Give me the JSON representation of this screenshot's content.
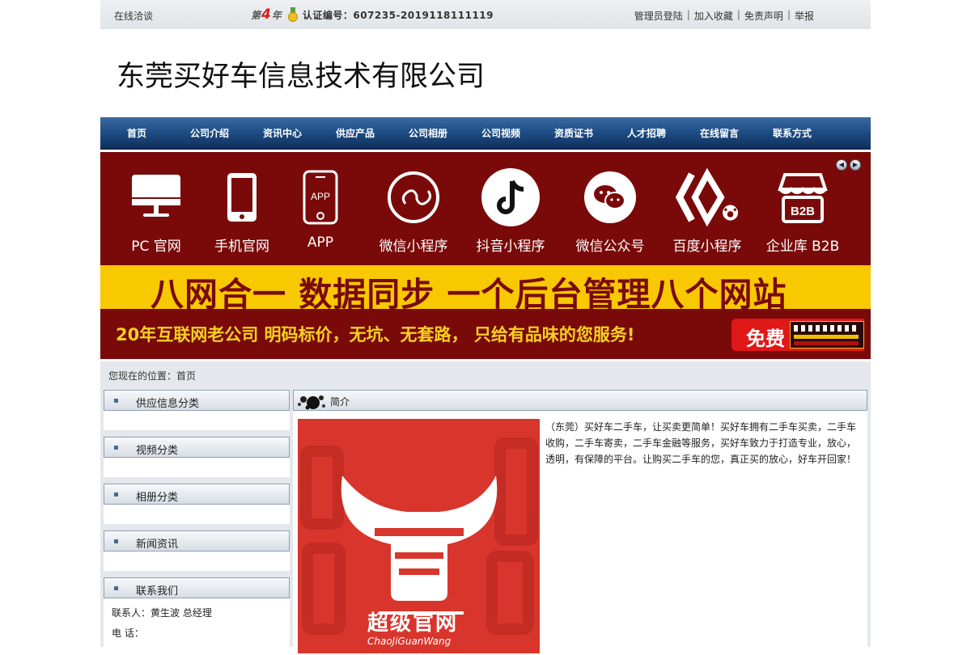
{
  "topbar": {
    "online": "在线洽谈",
    "year_prefix": "第",
    "year_num": "4",
    "year_suffix": "年",
    "cert_label": "认证编号：607235-2019118111119",
    "links": [
      "管理员登陆",
      "加入收藏",
      "免责声明",
      "举报"
    ]
  },
  "company_name": "东莞买好车信息技术有限公司",
  "nav": [
    "首页",
    "公司介绍",
    "资讯中心",
    "供应产品",
    "公司相册",
    "公司视频",
    "资质证书",
    "人才招聘",
    "在线留言",
    "联系方式"
  ],
  "banner": {
    "tiles": [
      {
        "label": "PC 官网",
        "icon": "monitor-icon"
      },
      {
        "label": "手机官网",
        "icon": "phone-icon"
      },
      {
        "label": "APP",
        "icon": "app-icon"
      },
      {
        "label": "微信小程序",
        "icon": "mini-program-icon"
      },
      {
        "label": "抖音小程序",
        "icon": "douyin-icon"
      },
      {
        "label": "微信公众号",
        "icon": "wechat-icon"
      },
      {
        "label": "百度小程序",
        "icon": "baidu-icon"
      },
      {
        "label": "企业库 B2B",
        "icon": "store-icon"
      }
    ],
    "tagline": "八网合一  数据同步  一个后台管理八个网站",
    "slogan": "20年互联网老公司  明码标价，无坑、无套路， 只给有品味的您服务!",
    "free": "免费",
    "colors": {
      "banner_bg": "#7a0a0a",
      "yellow": "#f8c800"
    }
  },
  "breadcrumb": "您现在的位置：首页",
  "sidebar": {
    "supply": "供应信息分类",
    "video": "视频分类",
    "album": "相册分类",
    "news": "新闻资讯",
    "contact": "联系我们",
    "contact_person": "联系人：黄生波 总经理",
    "contact_phone": "电  话："
  },
  "main": {
    "title": "简介",
    "image_caption": "超级官网",
    "image_sub": "ChaoJiGuanWang",
    "intro": "（东莞）买好车二手车，让买卖更简单！买好车拥有二手车买卖，二手车收购，二手车寄卖，二手车金融等服务，买好车致力于打造专业，放心，透明，有保障的平台。让购买二手车的您，真正买的放心，好车开回家！"
  }
}
